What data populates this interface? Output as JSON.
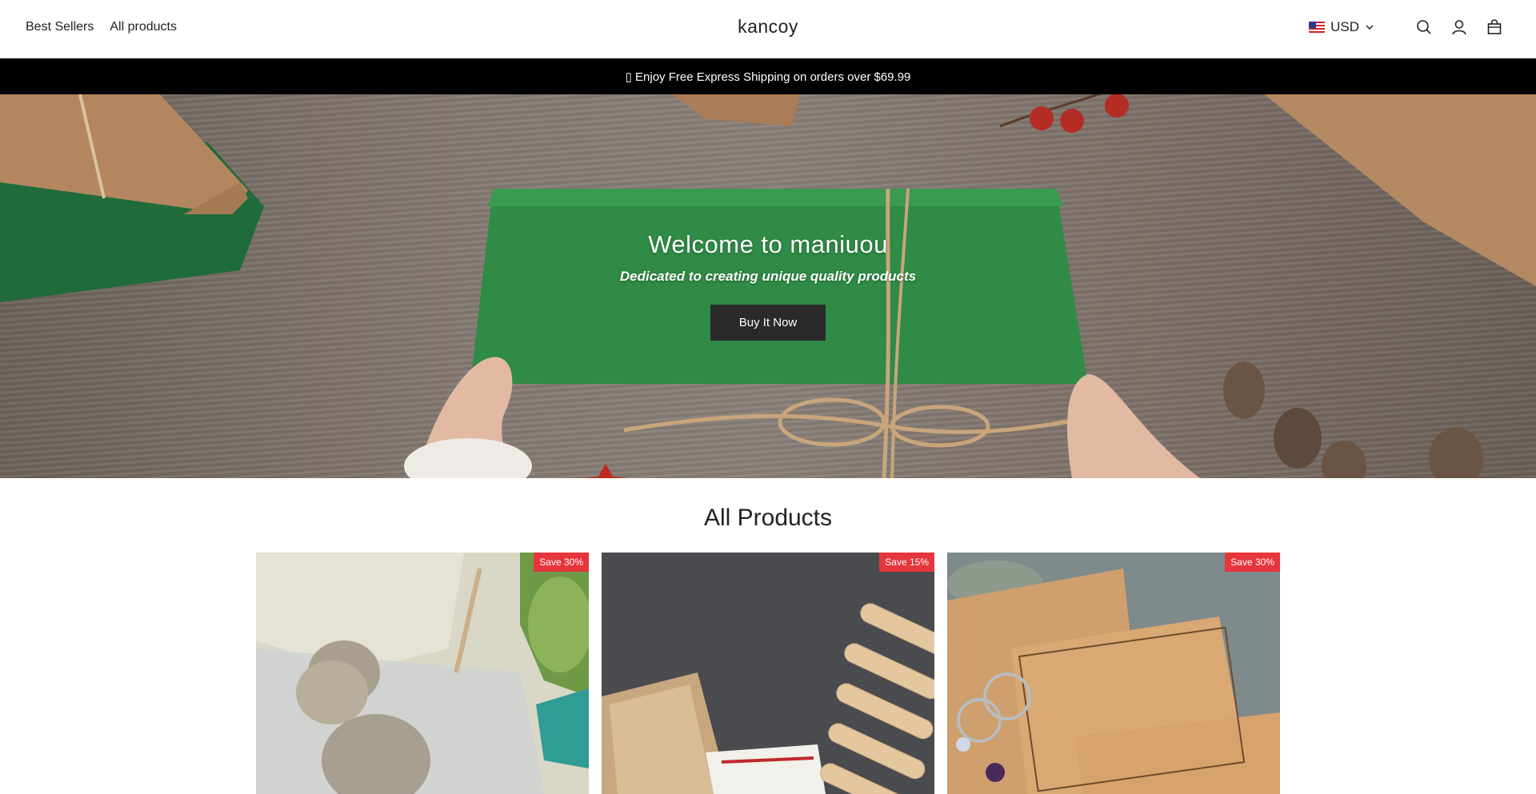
{
  "header": {
    "nav": [
      {
        "label": "Best Sellers"
      },
      {
        "label": "All products"
      }
    ],
    "logo": "kancoy",
    "currency": {
      "code": "USD",
      "flag_icon": "us-flag-icon"
    },
    "icons": [
      "search-icon",
      "account-icon",
      "cart-icon"
    ]
  },
  "announcement": {
    "text": "▯ Enjoy Free Express Shipping on orders over $69.99"
  },
  "hero": {
    "title": "Welcome to maniuou",
    "subtitle": "Dedicated to creating unique quality products",
    "button_label": "Buy It Now"
  },
  "products": {
    "title": "All Products",
    "items": [
      {
        "badge": "Save 30%"
      },
      {
        "badge": "Save 15%"
      },
      {
        "badge": "Save 30%"
      }
    ]
  },
  "colors": {
    "accent_badge": "#e5363d",
    "announcement_bg": "#000000",
    "button_bg": "#2a2a2a"
  }
}
